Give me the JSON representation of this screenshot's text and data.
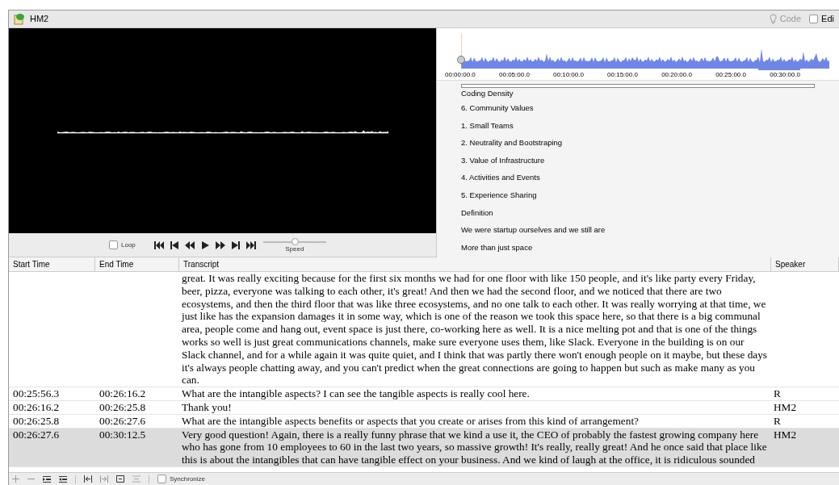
{
  "window": {
    "title": "HM2"
  },
  "toolbar": {
    "code": {
      "label": "Code",
      "disabled": true
    },
    "edit": {
      "label": "Edi",
      "checked": false
    }
  },
  "player": {
    "loop": {
      "label": "Loop",
      "checked": false
    },
    "speed": {
      "label": "Speed",
      "level": 0.5
    }
  },
  "timeline": {
    "ticks": [
      "00:00:00.0",
      "00:05:00.0",
      "00:10:00.0",
      "00:15:00.0",
      "00:20:00.0",
      "00:25:00.0",
      "00:30:00.0"
    ]
  },
  "codes": {
    "title": "Coding Density",
    "items": [
      "6. Community Values",
      "1. Small Teams",
      "2. Neutrality and Bootstraping",
      "3. Value of Infrastructure",
      "4. Activities and Events",
      "5. Experience Sharing",
      "Definition",
      "We were startup ourselves and we still are",
      "More than just space"
    ]
  },
  "table": {
    "columns": [
      "Start Time",
      "End Time",
      "Transcript",
      "Speaker"
    ],
    "rows": [
      {
        "start": "",
        "end": "",
        "text": "great. It was really exciting because for the first six months we had for one floor with like 150 people, and it's like party every Friday, beer, pizza, everyone was talking to each other, it's great! And then we had the second floor, and we noticed that there are two ecosystems, and then the third floor that was like three ecosystems, and no one talk to each other. It was really worrying at that time, we just like has the expansion damages it in some way, which is one of the reason we took this space here, so that there is a big communal area, people come and hang out, event space is just there, co-working here as well. It is a nice melting pot and that is one of the things works so well is just great communications channels, make sure everyone uses them, like Slack. Everyone in the building is on our Slack channel, and for a while again it was quite quiet, and I think that was partly there won't enough people on it maybe, but these days it's always people chatting away, and you can't predict when the great connections are going to happen but such as make many as you can.",
        "speaker": "",
        "selected": false
      },
      {
        "start": "00:25:56.3",
        "end": "00:26:16.2",
        "text": "What are the intangible aspects? I can see the tangible aspects is really cool here.",
        "speaker": "R",
        "selected": false
      },
      {
        "start": "00:26:16.2",
        "end": "00:26:25.8",
        "text": "Thank you!",
        "speaker": "HM2",
        "selected": false
      },
      {
        "start": "00:26:25.8",
        "end": "00:26:27.6",
        "text": "What are the intangible aspects benefits or aspects that you create or arises from this kind of arrangement?",
        "speaker": "R",
        "selected": false
      },
      {
        "start": "00:26:27.6",
        "end": "00:30:12.5",
        "text": "Very good question! Again, there is a really funny phrase that we kind a use it, the CEO of probably the fastest growing company here who has gone from 10 employees to 60 in the last two years, so massive growth! It's really, really great! And he once said that place like this is about the intangibles that can have tangible effect on your business. And we kind of laugh at the office, it is ridiculous sounded",
        "speaker": "HM2",
        "selected": true
      }
    ]
  },
  "bottom_bar": {
    "synchronize": {
      "label": "Synchronize",
      "checked": false
    }
  }
}
